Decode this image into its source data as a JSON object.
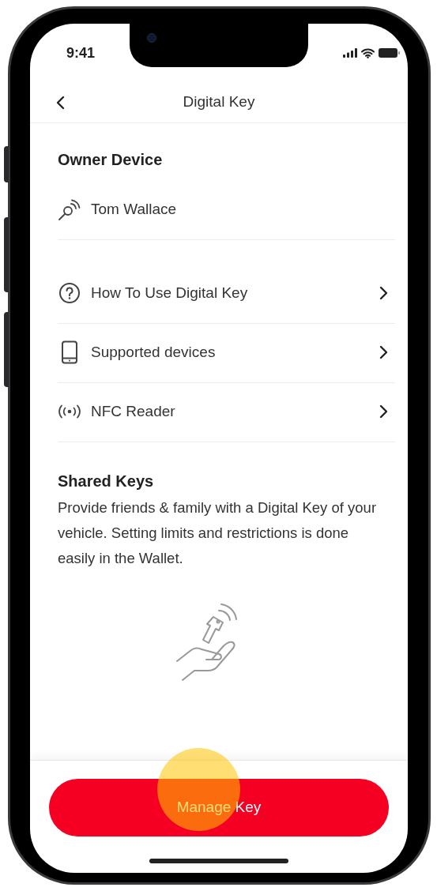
{
  "status_bar": {
    "time": "9:41"
  },
  "header": {
    "title": "Digital Key"
  },
  "owner_device": {
    "heading": "Owner Device",
    "name": "Tom Wallace"
  },
  "menu_items": [
    {
      "kind": "help",
      "label": "How To Use Digital Key"
    },
    {
      "kind": "device",
      "label": "Supported devices"
    },
    {
      "kind": "nfc",
      "label": "NFC Reader"
    }
  ],
  "shared_keys": {
    "heading": "Shared Keys",
    "description": "Provide friends & family with a Digital Key of your vehicle. Setting limits and restrictions is done easily in the Wallet."
  },
  "primary_button": {
    "label": "Manage Key",
    "touched": true
  }
}
